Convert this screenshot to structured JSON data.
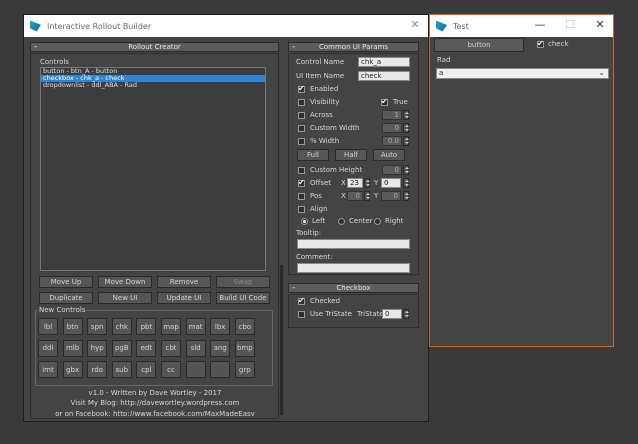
{
  "main_window": {
    "title": "Interactive Rollout Builder",
    "close_glyph": "✕"
  },
  "rollout_creator": {
    "title": "Rollout Creator",
    "collapse_glyph": "-",
    "controls_label": "Controls",
    "list_items": [
      {
        "label": "button - btn_A - button",
        "selected": false
      },
      {
        "label": "checkbox - chk_a - check",
        "selected": true
      },
      {
        "label": "dropdownlist - ddl_ABA - Rad",
        "selected": false
      }
    ],
    "buttons_row1": [
      "Move Up",
      "Move Down",
      "Remove",
      "Swap"
    ],
    "buttons_row2": [
      "Duplicate",
      "New UI",
      "Update UI",
      "Build UI Code"
    ],
    "new_controls_label": "New Controls",
    "new_controls": [
      [
        "lbl",
        "btn",
        "spn",
        "chk",
        "pbt",
        "map",
        "mat",
        "lbx",
        "cbo"
      ],
      [
        "ddl",
        "mlb",
        "hyp",
        "pgB",
        "edt",
        "cbt",
        "sld",
        "ang",
        "bmp"
      ],
      [
        "imt",
        "gbx",
        "rdo",
        "sub",
        "cpl",
        "cc",
        "",
        "",
        "grp"
      ]
    ],
    "footer": [
      "v1.0 - Written by Dave Wortley - 2017",
      "Visit My Blog: http://davewortley.wordpress.com",
      "or on Facebook: http://www.facebook.com/MaxMadeEasy"
    ]
  },
  "common_params": {
    "title": "Common UI Params",
    "collapse_glyph": "-",
    "control_name_label": "Control Name",
    "control_name_value": "chk_a",
    "ui_item_name_label": "UI Item Name",
    "ui_item_name_value": "check",
    "enabled_label": "Enabled",
    "visibility_label": "Visibility",
    "true_label": "True",
    "across_label": "Across",
    "across_value": "1",
    "custom_width_label": "Custom Width",
    "custom_width_value": "0",
    "pct_width_label": "% Width",
    "pct_width_value": "0.0",
    "full_label": "Full",
    "half_label": "Half",
    "auto_label": "Auto",
    "custom_height_label": "Custom Height",
    "custom_height_value": "0",
    "offset_label": "Offset",
    "offset_x_label": "X",
    "offset_x_value": "23",
    "offset_y_label": "Y",
    "offset_y_value": "0",
    "pos_label": "Pos",
    "pos_x_label": "X",
    "pos_x_value": "0",
    "pos_y_label": "Y",
    "pos_y_value": "0",
    "align_label": "Align",
    "left_label": "Left",
    "center_label": "Center",
    "right_label": "Right",
    "tooltip_label": "Tooltip:",
    "comment_label": "Comment:"
  },
  "checkbox_panel": {
    "title": "Checkbox",
    "collapse_glyph": "-",
    "checked_label": "Checked",
    "use_tristate_label": "Use TriState",
    "tristate_label": "TriState",
    "tristate_value": "0"
  },
  "test_window": {
    "title": "Test",
    "minimize_glyph": "—",
    "maximize_glyph": "☐",
    "close_glyph": "✕",
    "button_label": "button",
    "check_label": "check",
    "rad_label": "Rad",
    "dropdown_value": "a"
  }
}
